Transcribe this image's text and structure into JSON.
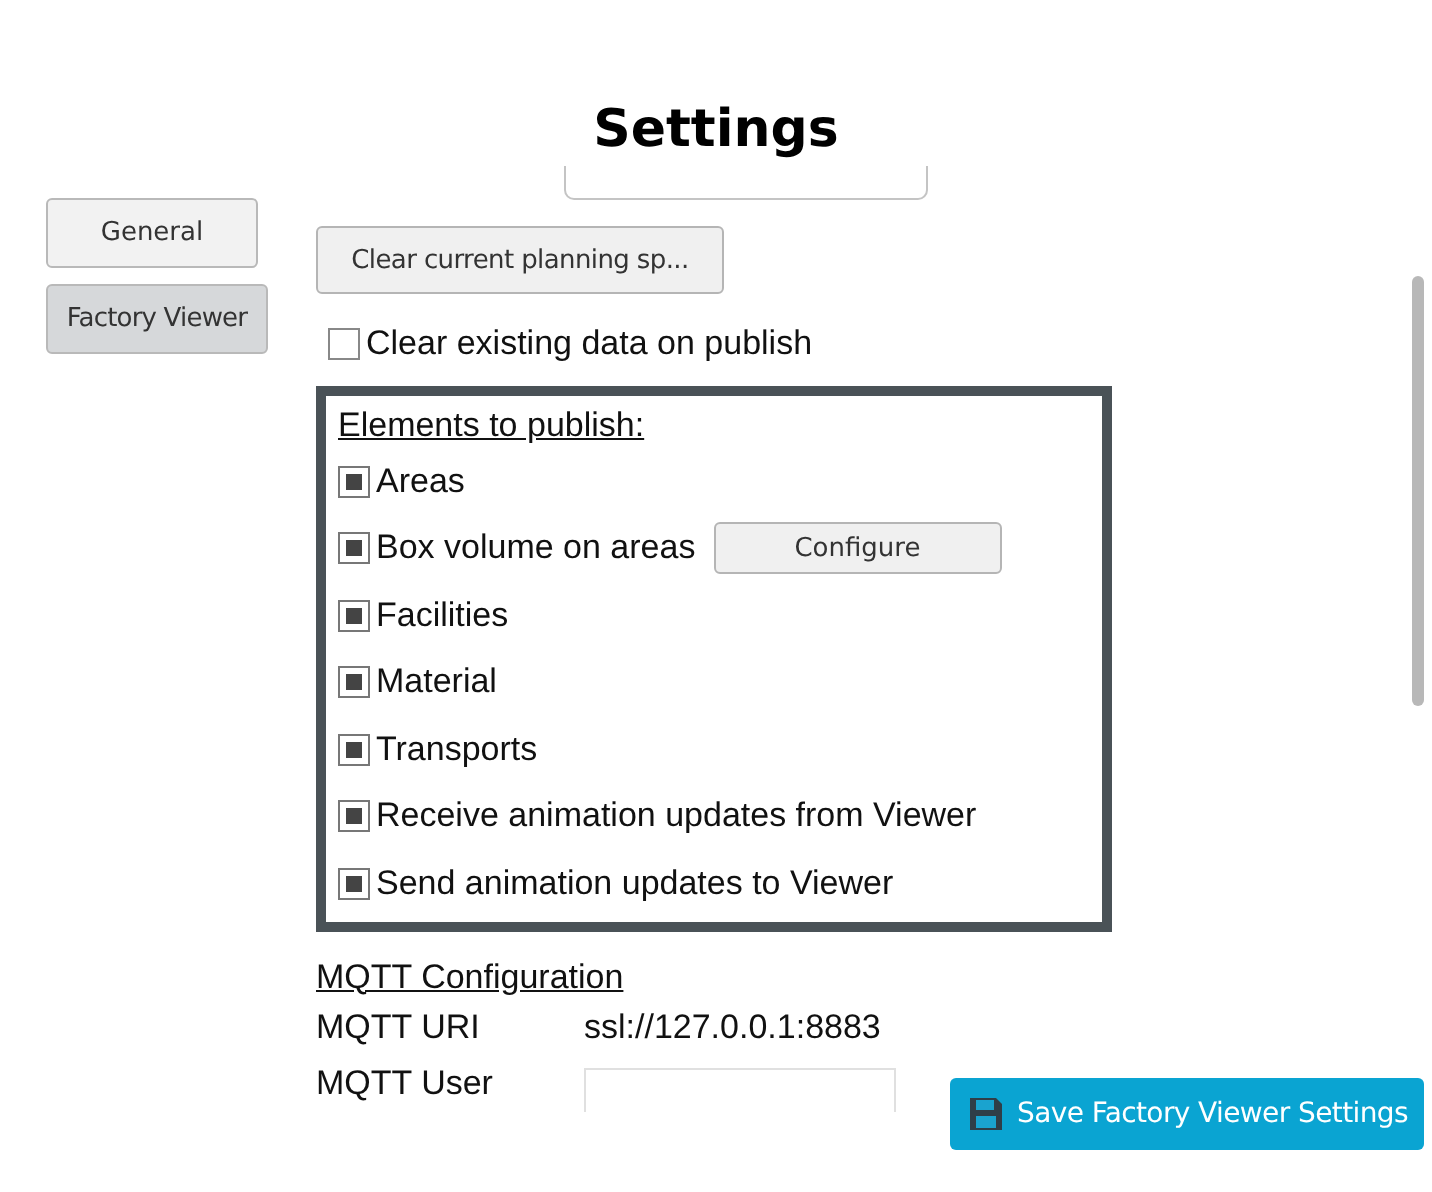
{
  "title": "Settings",
  "nav": [
    {
      "label": "General",
      "selected": false
    },
    {
      "label": "Factory Viewer",
      "selected": true
    }
  ],
  "clear_planning_button": "Clear current planning sp...",
  "clear_existing": {
    "label": "Clear existing data on publish",
    "checked": false
  },
  "elements": {
    "heading": "Elements to publish:",
    "items": [
      {
        "label": "Areas",
        "checked": true
      },
      {
        "label": "Box volume on areas",
        "checked": true,
        "button": "Configure"
      },
      {
        "label": "Facilities",
        "checked": true
      },
      {
        "label": "Material",
        "checked": true
      },
      {
        "label": "Transports",
        "checked": true
      },
      {
        "label": "Receive animation updates from Viewer",
        "checked": true
      },
      {
        "label": "Send animation updates to Viewer",
        "checked": true
      }
    ]
  },
  "mqtt": {
    "heading": "MQTT Configuration",
    "fields": [
      {
        "label": "MQTT URI",
        "kind": "text",
        "value": "ssl://127.0.0.1:8883"
      },
      {
        "label": "MQTT User",
        "kind": "input"
      }
    ]
  },
  "save_button": "Save Factory Viewer Settings"
}
